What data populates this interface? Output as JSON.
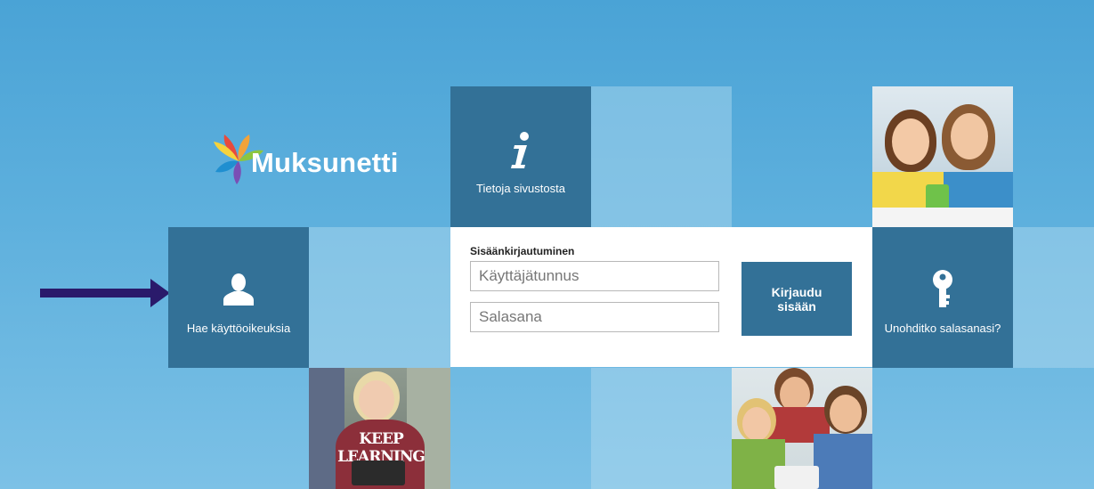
{
  "brand": {
    "name": "Muksunetti"
  },
  "tiles": {
    "info_label": "Tietoja sivustosta",
    "apply_label": "Hae käyttöoikeuksia",
    "forgot_label": "Unohditko salasanasi?"
  },
  "login": {
    "heading": "Sisäänkirjautuminen",
    "username_placeholder": "Käyttäjätunnus",
    "password_placeholder": "Salasana",
    "submit_label": "Kirjaudu sisään"
  },
  "photos": {
    "students_tablet_text": "KEEP LEARNING"
  },
  "colors": {
    "tile_dark": "#337197",
    "arrow": "#2a1a6b"
  }
}
